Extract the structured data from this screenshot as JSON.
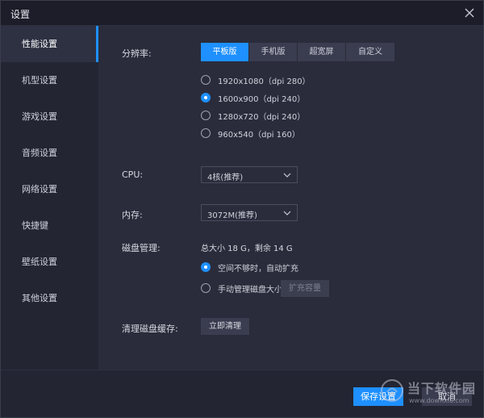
{
  "window": {
    "title": "设置"
  },
  "sidebar": {
    "items": [
      {
        "label": "性能设置",
        "active": true
      },
      {
        "label": "机型设置"
      },
      {
        "label": "游戏设置"
      },
      {
        "label": "音频设置"
      },
      {
        "label": "网络设置"
      },
      {
        "label": "快捷键"
      },
      {
        "label": "壁纸设置"
      },
      {
        "label": "其他设置"
      }
    ]
  },
  "performance": {
    "resolution_label": "分辨率:",
    "resolution_tabs": [
      {
        "label": "平板版",
        "active": true
      },
      {
        "label": "手机版"
      },
      {
        "label": "超宽屏"
      },
      {
        "label": "自定义"
      }
    ],
    "resolution_options": [
      {
        "label": "1920x1080（dpi 280）",
        "selected": false
      },
      {
        "label": "1600x900（dpi 240）",
        "selected": true
      },
      {
        "label": "1280x720（dpi 240）",
        "selected": false
      },
      {
        "label": "960x540（dpi 160）",
        "selected": false
      }
    ],
    "cpu_label": "CPU:",
    "cpu_value": "4核(推荐)",
    "memory_label": "内存:",
    "memory_value": "3072M(推荐)",
    "disk_label": "磁盘管理:",
    "disk_summary": "总大小 18 G，剩余 14 G",
    "disk_options": [
      {
        "label": "空间不够时，自动扩充",
        "selected": true
      },
      {
        "label": "手动管理磁盘大小",
        "selected": false
      }
    ],
    "expand_button": "扩充容量",
    "cache_label": "清理磁盘缓存:",
    "clean_button": "立即清理"
  },
  "footer": {
    "save_button": "保存设置",
    "cancel_button": "取消"
  },
  "watermark": {
    "text": "当下软件园",
    "url": "www.downxia.com"
  },
  "colors": {
    "accent": "#1e90ff",
    "sidebar_bg": "#232533",
    "content_bg": "#2a2c3b"
  }
}
